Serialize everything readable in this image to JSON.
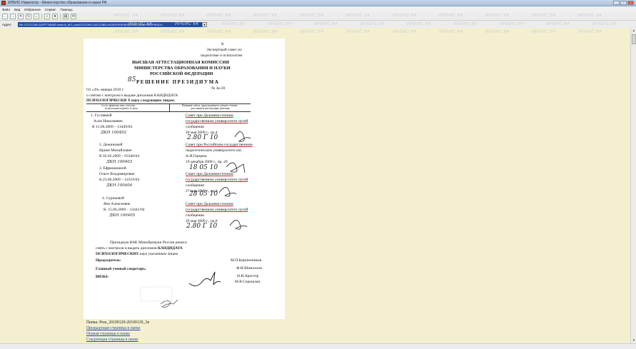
{
  "window": {
    "title": "ИРБИС-Навигатор - Министерство образования и науки РФ",
    "buttons": [
      "_",
      "□",
      "×"
    ]
  },
  "menu": [
    "Файл",
    "Вид",
    "Избранное",
    "Сервис",
    "Помощь"
  ],
  "toolbar": {
    "buttons": [
      "back-icon",
      "forward-icon",
      "stop-icon",
      "refresh-icon",
      "home-icon",
      "search-icon",
      "favorites-icon",
      "print-icon",
      "mail-icon"
    ]
  },
  "address": {
    "label": "Адрес",
    "value": "file:?C21COM=1&PFTNAME=search_MO_ww&S21CNR=2&I21DBN=MO&FREEPAR&I=MO_ww&FREEPAR&V="
  },
  "watermark": "ИРБИС 64",
  "document": {
    "addressee": [
      "К",
      "Экспертный совет по",
      "педагогике и психологии"
    ],
    "header": [
      "ВЫСШАЯ АТТЕСТАЦИОННАЯ КОМИССИЯ",
      "МИНИСТЕРСТВА ОБРАЗОВАНИЯ И НАУКИ",
      "РОССИЙСКОЙ ФЕДЕРАЦИИ"
    ],
    "decision_number_hw": "85",
    "decision_title": "РЕШЕНИЕ ПРЕЗИДИУМА",
    "date_line": "От «29» января   2010 г.",
    "number_line": "№   3к/28",
    "subject_line1": "о снятии с контроля и выдаче дипломов  КАНДИДАТА",
    "subject_line2": "ПСИХОЛОГИЧЕСКИ Х  наук следующим  лицам:",
    "col1_header": [
      "№ п/п, фамилия, имя, отчество",
      "(в дательном падеже), № дела"
    ],
    "col2_header": [
      "Название совета, присуждающего ученую степень,",
      "дата защиты диссертации, решения"
    ],
    "entries": [
      {
        "person": [
          "1. Гусляевой",
          "Алле Николаевне",
          "К 15.06.2009 – 13449/04"
        ],
        "diploma_hw": "ДКН  100402",
        "council": [
          "Совет      при      Дальневосточном",
          "государственном   университете    путей",
          "сообщения",
          "28 мая 2009 г., пр.4"
        ],
        "handwritten": "2.80 Г 10"
      },
      {
        "person": [
          "2. Дежиновой",
          "Ирине Михайловне",
          "К 02.02.2009 – 03340/04"
        ],
        "diploma_hw": "ДКН  100403",
        "council": [
          "Совет при  Российском государственном",
          "педагогическом  университете им.",
          "А.И.Герцена",
          "19 декабря  2008 г., пр.  20"
        ],
        "handwritten": "18 05 10"
      },
      {
        "person": [
          "3. Ефрюшкиной",
          "Ольге Владимировне",
          "К.23.06.2009 – 14319/04"
        ],
        "diploma_hw": "ДКН  100404",
        "council": [
          "Совет при   Дальневосточном",
          "государственном  университете путей",
          "сообщения",
          "27 мая 2009 г., пр.2"
        ],
        "handwritten": "28 05 10"
      },
      {
        "person": [
          "4. Суриковой",
          "Яне Алексеевне",
          "К. 15.06.2009 – 13441/04"
        ],
        "diploma_hw": "ДКН  100405",
        "council": [
          "Совет при  Дальневосточном",
          "государственном  университете путей",
          "сообщения",
          "29 мая 2009 г., пр.8"
        ],
        "handwritten": "2.80 Г 10"
      }
    ],
    "presidium_line1": "Президиум ВАК Минобрнауки России решил:",
    "presidium_line2a": "снять с контроля и выдать дипломов ",
    "presidium_line2b": "КАНДИДАТА",
    "presidium_line3a": "ПСИХОЛОГИЧЕСКИХ",
    "presidium_line3b": " наук указанным  лицам",
    "chair_label": "Председатель:",
    "chair_name": "М.П.Кирпичников",
    "secretary_label": "Главный ученый секретарь:",
    "secretary_name": "Ф.И.Шамхалов",
    "visa_label": "ВИЗЫ:",
    "visa_names": [
      "Н.И.Аристер",
      "М.В.Серошлан"
    ]
  },
  "footer": {
    "folder": "Папка: Реш_20100129-20100129_3к",
    "links": [
      "Предыдущая страница в папке",
      "Первая страница в папке",
      "Следующая страница в папке"
    ]
  }
}
